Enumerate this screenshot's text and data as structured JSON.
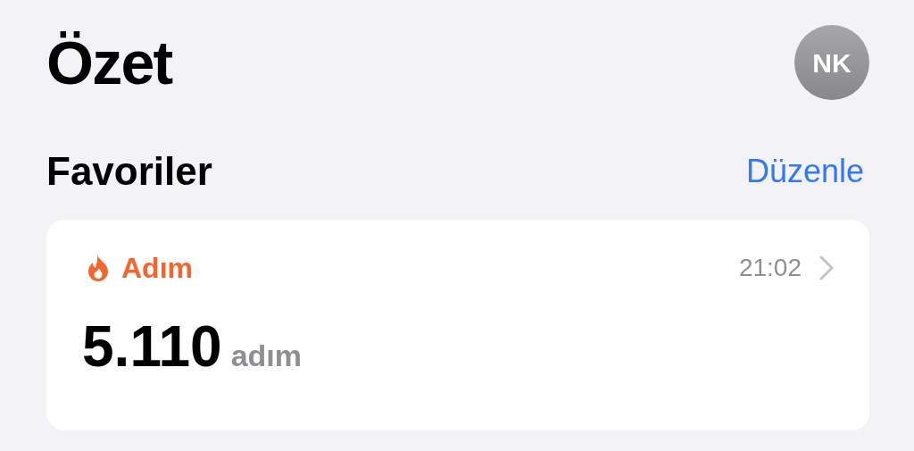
{
  "header": {
    "title": "Özet",
    "avatar_initials": "NK"
  },
  "section": {
    "title": "Favoriler",
    "action": "Düzenle"
  },
  "card": {
    "category": "Adım",
    "time": "21:02",
    "value": "5.110",
    "unit": "adım"
  }
}
